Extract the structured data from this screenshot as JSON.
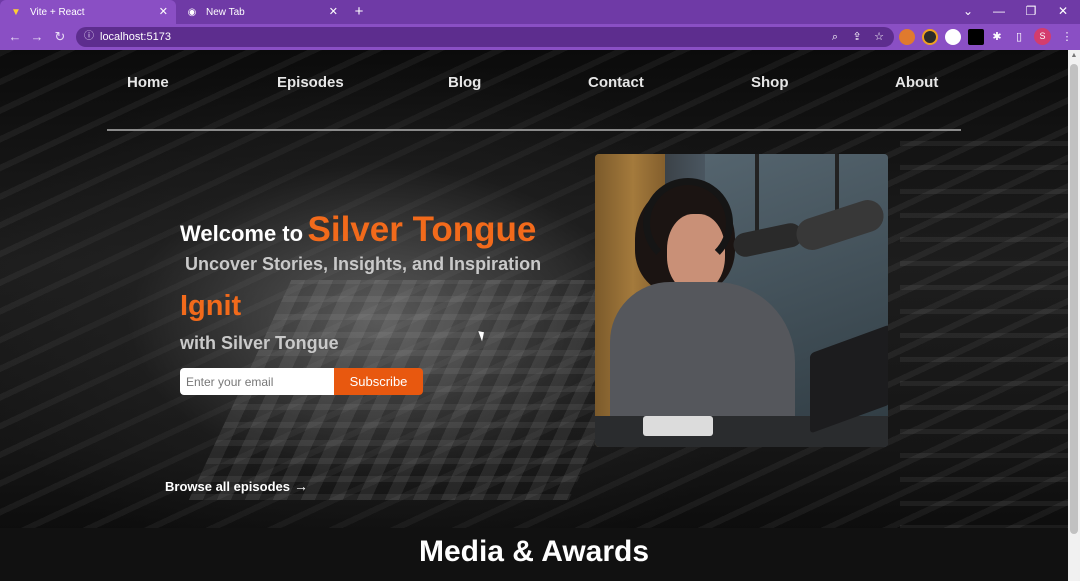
{
  "browser": {
    "tabs": [
      {
        "title": "Vite + React",
        "favicon": "vite-icon",
        "active": true
      },
      {
        "title": "New Tab",
        "favicon": "chrome-icon",
        "active": false
      }
    ],
    "new_tab": "+",
    "address": "localhost:5173",
    "icons": {
      "back": "←",
      "forward": "→",
      "reload": "↻",
      "info": "ⓘ",
      "zoom": "⌕",
      "share": "⇪",
      "star": "☆",
      "puzzle": "✱",
      "sidebar": "▯",
      "menu": "⋮",
      "tab_search": "⌄",
      "minimize": "—",
      "restore": "❐",
      "close": "✕"
    },
    "profile_initial": "S",
    "accent": "#8a4fc4"
  },
  "nav": {
    "items": [
      "Home",
      "Episodes",
      "Blog",
      "Contact",
      "Shop",
      "About"
    ]
  },
  "hero": {
    "welcome_prefix": "Welcome to",
    "brand": "Silver Tongue",
    "tagline": "Uncover Stories, Insights, and Inspiration",
    "ignit": "Ignit",
    "with_text": "with Silver Tongue",
    "email_placeholder": "Enter your email",
    "subscribe_label": "Subscribe",
    "browse_label": "Browse all episodes",
    "browse_arrow": "→",
    "accent_color": "#f26a1b"
  },
  "media": {
    "title": "Media & Awards"
  }
}
